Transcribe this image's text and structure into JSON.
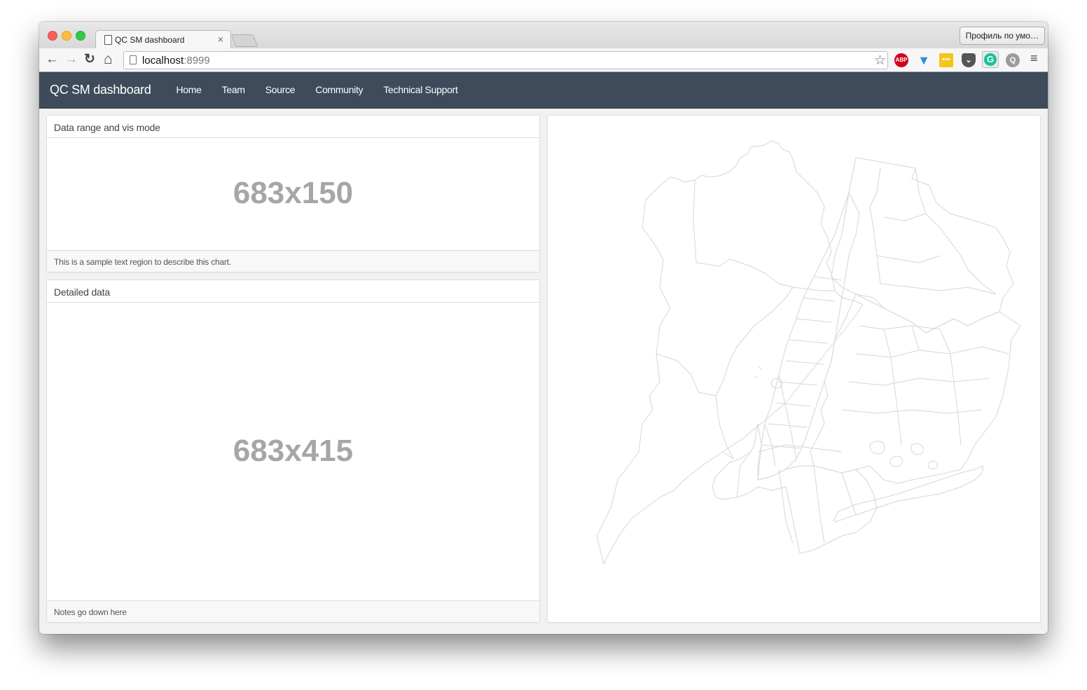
{
  "browser": {
    "tab_title": "QC SM dashboard",
    "tab_close_glyph": "×",
    "profile_button": "Профиль по умо…",
    "url_host": "localhost",
    "url_port": ":8999",
    "back_glyph": "←",
    "forward_glyph": "→",
    "reload_glyph": "↻",
    "home_glyph": "⌂",
    "star_glyph": "☆",
    "menu_glyph": "≡",
    "extensions": [
      {
        "name": "adblock-plus",
        "label": "ABP",
        "color": "#d0021b"
      },
      {
        "name": "gem-extension",
        "label": "▼",
        "color": "#2a8cd6"
      },
      {
        "name": "dots-extension",
        "label": "•••",
        "color": "#f5c518"
      },
      {
        "name": "pocket",
        "label": "⌄",
        "color": "#555555"
      },
      {
        "name": "grammarly",
        "label": "G",
        "color": "#15c39a"
      },
      {
        "name": "q-extension",
        "label": "Q",
        "color": "#9b9b9b"
      }
    ]
  },
  "navbar": {
    "brand": "QC SM dashboard",
    "background": "#3d4b5a",
    "links": [
      "Home",
      "Team",
      "Source",
      "Community",
      "Technical Support"
    ]
  },
  "panels": {
    "range": {
      "heading": "Data range and vis mode",
      "placeholder": "683x150",
      "footer": "This is a sample text region to describe this chart."
    },
    "detail": {
      "heading": "Detailed data",
      "placeholder": "683x415",
      "footer": "Notes go down here"
    },
    "map": {
      "description": "NYC community districts outline map",
      "stroke_color": "#d6d6d6"
    }
  }
}
